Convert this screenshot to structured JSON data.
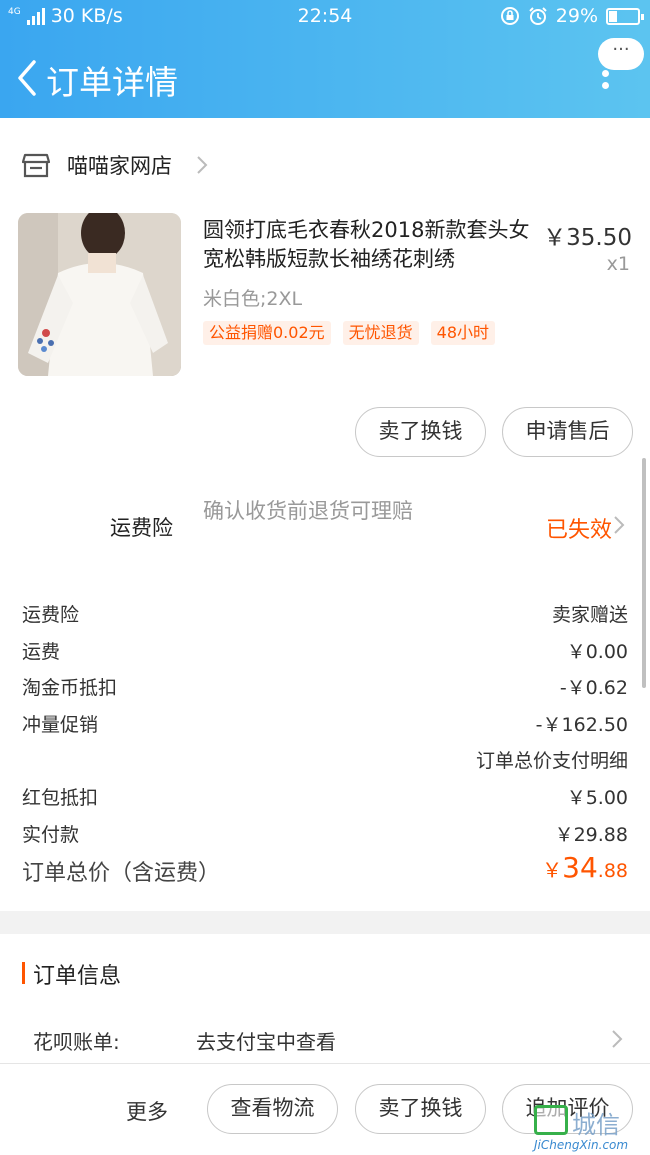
{
  "status_bar": {
    "net_type": "4G",
    "speed": "30 KB/s",
    "time": "22:54",
    "battery": "29%"
  },
  "nav": {
    "title": "订单详情",
    "more_bubble": "···"
  },
  "shop": {
    "name": "喵喵家网店"
  },
  "product": {
    "title": "圆领打底毛衣春秋2018新款套头女宽松韩版短款长袖绣花刺绣",
    "price": "￥35.50",
    "quantity": "x1",
    "sku": "米白色;2XL",
    "tags": [
      "公益捐赠0.02元",
      "无忧退货",
      "48小时"
    ]
  },
  "item_actions": {
    "sell_label": "卖了换钱",
    "after_sale_label": "申请售后"
  },
  "insurance": {
    "label": "运费险",
    "desc": "确认收货前退货可理赔",
    "status": "已失效"
  },
  "fees": [
    {
      "label": "运费险",
      "value": "卖家赠送"
    },
    {
      "label": "运费",
      "value": "￥0.00"
    },
    {
      "label": "淘金币抵扣",
      "value": "-￥0.62"
    },
    {
      "label": "冲量促销",
      "value": "-￥162.50"
    },
    {
      "label": "",
      "value": "订单总价支付明细"
    },
    {
      "label": "红包抵扣",
      "value": "￥5.00"
    },
    {
      "label": "实付款",
      "value": "￥29.88"
    }
  ],
  "total": {
    "label": "订单总价（含运费）",
    "currency": "￥",
    "integer": "34",
    "decimal": ".88"
  },
  "order_info": {
    "title": "订单信息",
    "huabei_label": "花呗账单:",
    "huabei_link": "去支付宝中查看"
  },
  "bottom_bar": {
    "more": "更多",
    "logistics": "查看物流",
    "sell": "卖了换钱",
    "review": "追加评价"
  },
  "watermark": {
    "cn": "城信",
    "en": "JiChengXin.com"
  },
  "colors": {
    "header_start": "#3aa6f0",
    "header_end": "#5cc4f0",
    "accent": "#ff5500",
    "tag_bg": "#fff0e8"
  }
}
